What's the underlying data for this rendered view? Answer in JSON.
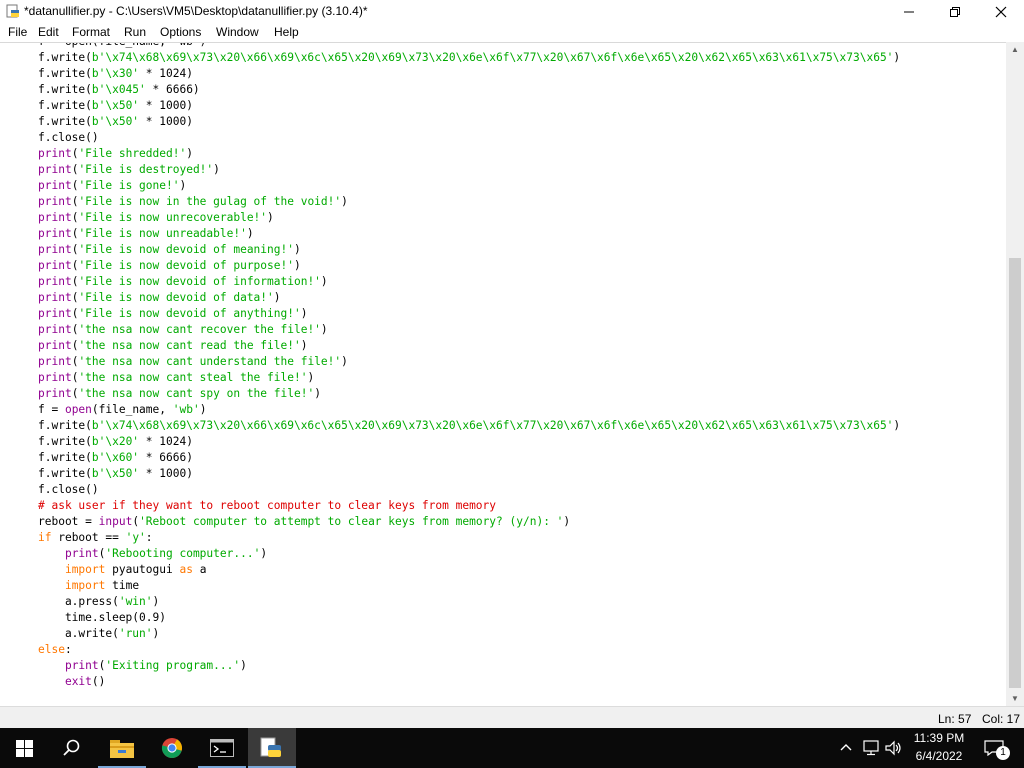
{
  "window": {
    "title": "*datanullifier.py - C:\\Users\\VM5\\Desktop\\datanullifier.py (3.10.4)*"
  },
  "menu": [
    "File",
    "Edit",
    "Format",
    "Run",
    "Options",
    "Window",
    "Help"
  ],
  "code_colors": {
    "keyword": "#ff7700",
    "builtin": "#900090",
    "string": "#00aa00",
    "comment": "#dd0000",
    "default": "#000000"
  },
  "code_lines": [
    [
      [
        "d",
        "f = open(file_name, 'wb')"
      ]
    ],
    [
      [
        "d",
        "f.write("
      ],
      [
        "s",
        "b'\\x74\\x68\\x69\\x73\\x20\\x66\\x69\\x6c\\x65\\x20\\x69\\x73\\x20\\x6e\\x6f\\x77\\x20\\x67\\x6f\\x6e\\x65\\x20\\x62\\x65\\x63\\x61\\x75\\x73\\x65'"
      ],
      [
        "d",
        ")"
      ]
    ],
    [
      [
        "d",
        "f.write("
      ],
      [
        "s",
        "b'\\x30'"
      ],
      [
        "d",
        " * 1024)"
      ]
    ],
    [
      [
        "d",
        "f.write("
      ],
      [
        "s",
        "b'\\x045'"
      ],
      [
        "d",
        " * 6666)"
      ]
    ],
    [
      [
        "d",
        "f.write("
      ],
      [
        "s",
        "b'\\x50'"
      ],
      [
        "d",
        " * 1000)"
      ]
    ],
    [
      [
        "d",
        "f.write("
      ],
      [
        "s",
        "b'\\x50'"
      ],
      [
        "d",
        " * 1000)"
      ]
    ],
    [
      [
        "d",
        "f.close()"
      ]
    ],
    [
      [
        "b",
        "print"
      ],
      [
        "d",
        "("
      ],
      [
        "s",
        "'File shredded!'"
      ],
      [
        "d",
        ")"
      ]
    ],
    [
      [
        "b",
        "print"
      ],
      [
        "d",
        "("
      ],
      [
        "s",
        "'File is destroyed!'"
      ],
      [
        "d",
        ")"
      ]
    ],
    [
      [
        "b",
        "print"
      ],
      [
        "d",
        "("
      ],
      [
        "s",
        "'File is gone!'"
      ],
      [
        "d",
        ")"
      ]
    ],
    [
      [
        "b",
        "print"
      ],
      [
        "d",
        "("
      ],
      [
        "s",
        "'File is now in the gulag of the void!'"
      ],
      [
        "d",
        ")"
      ]
    ],
    [
      [
        "b",
        "print"
      ],
      [
        "d",
        "("
      ],
      [
        "s",
        "'File is now unrecoverable!'"
      ],
      [
        "d",
        ")"
      ]
    ],
    [
      [
        "b",
        "print"
      ],
      [
        "d",
        "("
      ],
      [
        "s",
        "'File is now unreadable!'"
      ],
      [
        "d",
        ")"
      ]
    ],
    [
      [
        "b",
        "print"
      ],
      [
        "d",
        "("
      ],
      [
        "s",
        "'File is now devoid of meaning!'"
      ],
      [
        "d",
        ")"
      ]
    ],
    [
      [
        "b",
        "print"
      ],
      [
        "d",
        "("
      ],
      [
        "s",
        "'File is now devoid of purpose!'"
      ],
      [
        "d",
        ")"
      ]
    ],
    [
      [
        "b",
        "print"
      ],
      [
        "d",
        "("
      ],
      [
        "s",
        "'File is now devoid of information!'"
      ],
      [
        "d",
        ")"
      ]
    ],
    [
      [
        "b",
        "print"
      ],
      [
        "d",
        "("
      ],
      [
        "s",
        "'File is now devoid of data!'"
      ],
      [
        "d",
        ")"
      ]
    ],
    [
      [
        "b",
        "print"
      ],
      [
        "d",
        "("
      ],
      [
        "s",
        "'File is now devoid of anything!'"
      ],
      [
        "d",
        ")"
      ]
    ],
    [
      [
        "b",
        "print"
      ],
      [
        "d",
        "("
      ],
      [
        "s",
        "'the nsa now cant recover the file!'"
      ],
      [
        "d",
        ")"
      ]
    ],
    [
      [
        "b",
        "print"
      ],
      [
        "d",
        "("
      ],
      [
        "s",
        "'the nsa now cant read the file!'"
      ],
      [
        "d",
        ")"
      ]
    ],
    [
      [
        "b",
        "print"
      ],
      [
        "d",
        "("
      ],
      [
        "s",
        "'the nsa now cant understand the file!'"
      ],
      [
        "d",
        ")"
      ]
    ],
    [
      [
        "b",
        "print"
      ],
      [
        "d",
        "("
      ],
      [
        "s",
        "'the nsa now cant steal the file!'"
      ],
      [
        "d",
        ")"
      ]
    ],
    [
      [
        "b",
        "print"
      ],
      [
        "d",
        "("
      ],
      [
        "s",
        "'the nsa now cant spy on the file!'"
      ],
      [
        "d",
        ")"
      ]
    ],
    [
      [
        "d",
        "f = "
      ],
      [
        "b",
        "open"
      ],
      [
        "d",
        "(file_name, "
      ],
      [
        "s",
        "'wb'"
      ],
      [
        "d",
        ")"
      ]
    ],
    [
      [
        "d",
        "f.write("
      ],
      [
        "s",
        "b'\\x74\\x68\\x69\\x73\\x20\\x66\\x69\\x6c\\x65\\x20\\x69\\x73\\x20\\x6e\\x6f\\x77\\x20\\x67\\x6f\\x6e\\x65\\x20\\x62\\x65\\x63\\x61\\x75\\x73\\x65'"
      ],
      [
        "d",
        ")"
      ]
    ],
    [
      [
        "d",
        "f.write("
      ],
      [
        "s",
        "b'\\x20'"
      ],
      [
        "d",
        " * 1024)"
      ]
    ],
    [
      [
        "d",
        "f.write("
      ],
      [
        "s",
        "b'\\x60'"
      ],
      [
        "d",
        " * 6666)"
      ]
    ],
    [
      [
        "d",
        "f.write("
      ],
      [
        "s",
        "b'\\x50'"
      ],
      [
        "d",
        " * 1000)"
      ]
    ],
    [
      [
        "d",
        "f.close()"
      ]
    ],
    [
      [
        "c",
        "# ask user if they want to reboot computer to clear keys from memory"
      ]
    ],
    [
      [
        "d",
        "reboot = "
      ],
      [
        "b",
        "input"
      ],
      [
        "d",
        "("
      ],
      [
        "s",
        "'Reboot computer to attempt to clear keys from memory? (y/n): '"
      ],
      [
        "d",
        ")"
      ]
    ],
    [
      [
        "k",
        "if"
      ],
      [
        "d",
        " reboot == "
      ],
      [
        "s",
        "'y'"
      ],
      [
        "d",
        ":"
      ]
    ],
    [
      [
        "d",
        "    "
      ],
      [
        "b",
        "print"
      ],
      [
        "d",
        "("
      ],
      [
        "s",
        "'Rebooting computer...'"
      ],
      [
        "d",
        ")"
      ]
    ],
    [
      [
        "d",
        "    "
      ],
      [
        "k",
        "import"
      ],
      [
        "d",
        " pyautogui "
      ],
      [
        "k",
        "as"
      ],
      [
        "d",
        " a"
      ]
    ],
    [
      [
        "d",
        "    "
      ],
      [
        "k",
        "import"
      ],
      [
        "d",
        " time"
      ]
    ],
    [
      [
        "d",
        "    a.press("
      ],
      [
        "s",
        "'win'"
      ],
      [
        "d",
        ")"
      ]
    ],
    [
      [
        "d",
        "    time.sleep(0.9)"
      ]
    ],
    [
      [
        "d",
        "    a.write("
      ],
      [
        "s",
        "'run'"
      ],
      [
        "d",
        ")"
      ]
    ],
    [
      [
        "k",
        "else"
      ],
      [
        "d",
        ":"
      ]
    ],
    [
      [
        "d",
        "    "
      ],
      [
        "b",
        "print"
      ],
      [
        "d",
        "("
      ],
      [
        "s",
        "'Exiting program...'"
      ],
      [
        "d",
        ")"
      ]
    ],
    [
      [
        "d",
        "    "
      ],
      [
        "b",
        "exit"
      ],
      [
        "d",
        "()"
      ]
    ]
  ],
  "status": {
    "line": "Ln: 57",
    "col": "Col: 17"
  },
  "taskbar": {
    "time": "11:39 PM",
    "date": "6/4/2022",
    "notification_count": "1",
    "icons": [
      "windows-start-icon",
      "search-icon",
      "file-explorer-icon",
      "chrome-icon",
      "terminal-icon",
      "python-idle-icon"
    ]
  }
}
